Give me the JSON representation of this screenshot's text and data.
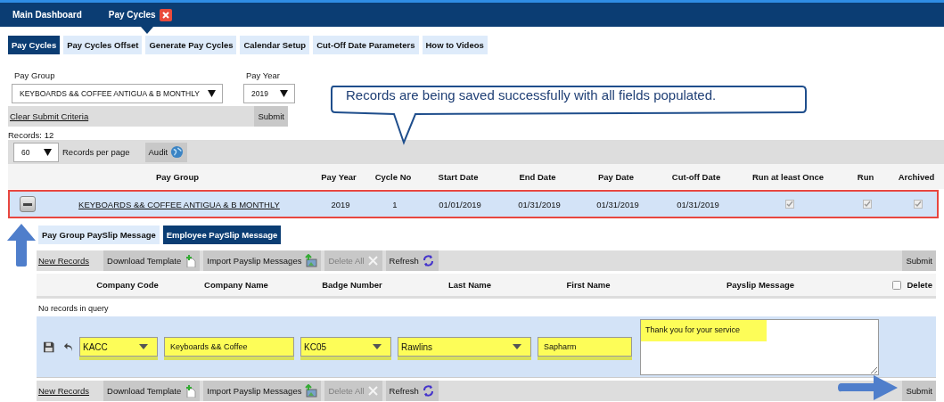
{
  "top_tabs": [
    {
      "label": "Main Dashboard",
      "selected": false,
      "closable": false
    },
    {
      "label": "Pay Cycles",
      "selected": true,
      "closable": true
    }
  ],
  "sub_tabs": [
    {
      "label": "Pay Cycles",
      "selected": true
    },
    {
      "label": "Pay Cycles Offset",
      "selected": false
    },
    {
      "label": "Generate Pay Cycles",
      "selected": false
    },
    {
      "label": "Calendar Setup",
      "selected": false
    },
    {
      "label": "Cut-Off Date Parameters",
      "selected": false
    },
    {
      "label": "How to Videos",
      "selected": false
    }
  ],
  "filters": {
    "pay_group": {
      "label": "Pay Group",
      "value": "KEYBOARDS && COFFEE ANTIGUA & B MONTHLY"
    },
    "pay_year": {
      "label": "Pay Year",
      "value": "2019"
    }
  },
  "criteria_bar": {
    "clear_link": "Clear Submit Criteria",
    "submit": "Submit"
  },
  "records": "Records:  12",
  "paging": {
    "per_page": "60",
    "label": "Records per page",
    "audit": "Audit"
  },
  "table": {
    "columns": [
      "Pay Group",
      "Pay Year",
      "Cycle No",
      "Start Date",
      "End Date",
      "Pay Date",
      "Cut-off Date",
      "Run at least Once",
      "Run",
      "Archived"
    ],
    "rows": [
      {
        "expanded": true,
        "highlighted": true,
        "pay_group": "KEYBOARDS && COFFEE ANTIGUA & B MONTHLY",
        "pay_year": "2019",
        "cycle_no": "1",
        "start_date": "01/01/2019",
        "end_date": "01/31/2019",
        "pay_date": "01/31/2019",
        "cutoff_date": "01/31/2019",
        "run_at_least_once": true,
        "run": true,
        "archived": true
      }
    ]
  },
  "message_tabs": [
    {
      "label": "Pay Group PaySlip Message",
      "selected": false
    },
    {
      "label": "Employee PaySlip Message",
      "selected": true
    }
  ],
  "toolbars": [
    {
      "new_records": "New Records",
      "buttons": [
        {
          "label": "Download Template",
          "kind": "download",
          "disabled": false
        },
        {
          "label": "Import Payslip Messages",
          "kind": "import",
          "disabled": false
        },
        {
          "label": "Delete All",
          "kind": "delete",
          "disabled": true
        },
        {
          "label": "Refresh",
          "kind": "refresh",
          "disabled": false
        }
      ],
      "submit": "Submit"
    },
    {
      "new_records": "New Records",
      "buttons": [
        {
          "label": "Download Template",
          "kind": "download",
          "disabled": false
        },
        {
          "label": "Import Payslip Messages",
          "kind": "import",
          "disabled": false
        },
        {
          "label": "Delete All",
          "kind": "delete",
          "disabled": true
        },
        {
          "label": "Refresh",
          "kind": "refresh",
          "disabled": false
        }
      ],
      "submit": "Submit"
    }
  ],
  "sub_table": {
    "columns": [
      "Company Code",
      "Company Name",
      "Badge Number",
      "Last Name",
      "First Name",
      "Payslip Message"
    ],
    "delete_label": "Delete",
    "delete_checked": false,
    "empty": "No records in query"
  },
  "edit_row": {
    "fields": [
      {
        "kind": "select",
        "value": "KACC",
        "highlighted": true
      },
      {
        "kind": "text",
        "value": "Keyboards && Coffee",
        "highlighted": true
      },
      {
        "kind": "select",
        "value": "KC05",
        "highlighted": true
      },
      {
        "kind": "select",
        "value": "Rawlins",
        "highlighted": true
      },
      {
        "kind": "text",
        "value": "Sapharm",
        "highlighted": true
      }
    ],
    "message": {
      "value": "Thank you for your service",
      "highlighted": true
    }
  },
  "callout": {
    "text": "Records are being saved successfully with all fields populated."
  }
}
